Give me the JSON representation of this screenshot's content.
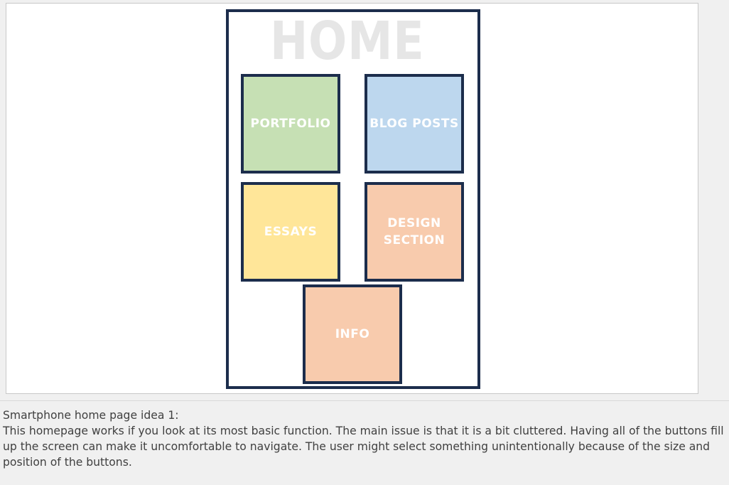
{
  "slide": {
    "home_title": "HOME",
    "tiles": [
      {
        "label": "PORTFOLIO",
        "color": "#c6e0b4"
      },
      {
        "label": "BLOG POSTS",
        "color": "#bdd7ee"
      },
      {
        "label": "ESSAYS",
        "color": "#ffe699"
      },
      {
        "label": "DESIGN\nSECTION",
        "color": "#f8cbad"
      },
      {
        "label": "INFO",
        "color": "#f8cbad"
      }
    ],
    "frame_color": "#1c2d4c"
  },
  "notes": {
    "heading": "Smartphone home page idea 1:",
    "body": "This homepage works if you look at its most basic function. The main issue is that it is a bit cluttered. Having all of the buttons fill up the screen can make it uncomfortable to navigate. The user might select something unintentionally because of the size and position of the buttons."
  }
}
